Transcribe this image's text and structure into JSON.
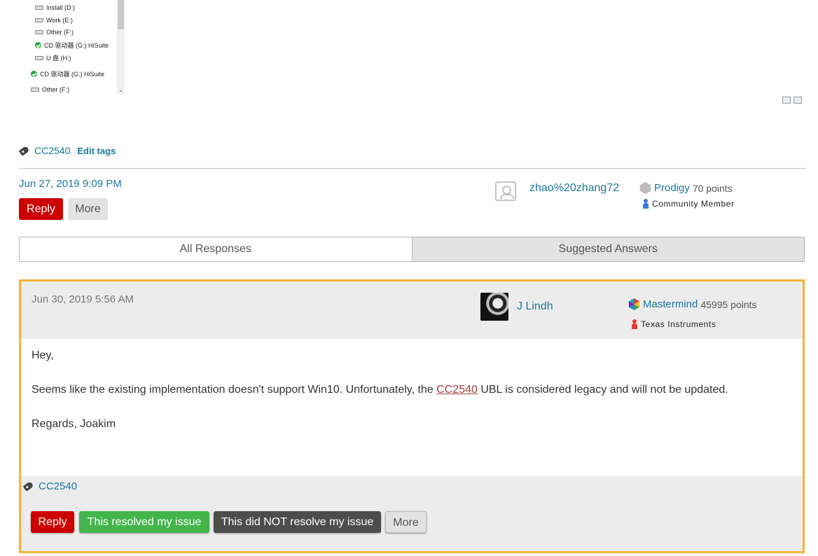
{
  "explorer": {
    "drives": [
      {
        "label": "Install (D:)",
        "kind": "drive"
      },
      {
        "label": "Work (E:)",
        "kind": "drive"
      },
      {
        "label": "Other (F:)",
        "kind": "drive"
      },
      {
        "label": "CD 驱动器 (G:) HiSuite",
        "kind": "cd"
      },
      {
        "label": "U 盘 (H:)",
        "kind": "drive"
      },
      {
        "label": "CD 驱动器 (G:) HiSuite",
        "kind": "cd"
      },
      {
        "label": "Other (F:)",
        "kind": "drive"
      }
    ],
    "scroll_arrow": "⌄"
  },
  "question": {
    "tag": "CC2540",
    "edit_tags_label": "Edit tags",
    "date": "Jun 27, 2019 9:09 PM",
    "reply_label": "Reply",
    "more_label": "More",
    "author": {
      "name": "zhao%20zhang72",
      "rank": "Prodigy",
      "points": "70 points",
      "role": "Community Member",
      "role_color": "#3a78d6"
    }
  },
  "tabs": [
    {
      "label": "All Responses",
      "active": true
    },
    {
      "label": "Suggested Answers",
      "active": false
    }
  ],
  "answer": {
    "date": "Jun 30, 2019 5:56 AM",
    "author": {
      "name": "J Lindh",
      "rank": "Mastermind",
      "points": "45995 points",
      "role": "Texas Instruments",
      "role_color": "#e53935"
    },
    "body": {
      "greeting": "Hey,",
      "line_before": "Seems like the existing implementation doesn't support Win10. Unfortunately, the ",
      "link": "CC2540",
      "line_after": " UBL is considered legacy and will not be updated.",
      "signoff": "Regards, Joakim"
    },
    "tag": "CC2540",
    "buttons": {
      "reply": "Reply",
      "resolved": "This resolved my issue",
      "not_resolved": "This did NOT resolve my issue",
      "more": "More"
    }
  },
  "colors": {
    "accent_link": "#1a7898",
    "reply_red": "#cc0000",
    "resolved_green": "#43b54b",
    "highlight_border": "#f5b335"
  }
}
